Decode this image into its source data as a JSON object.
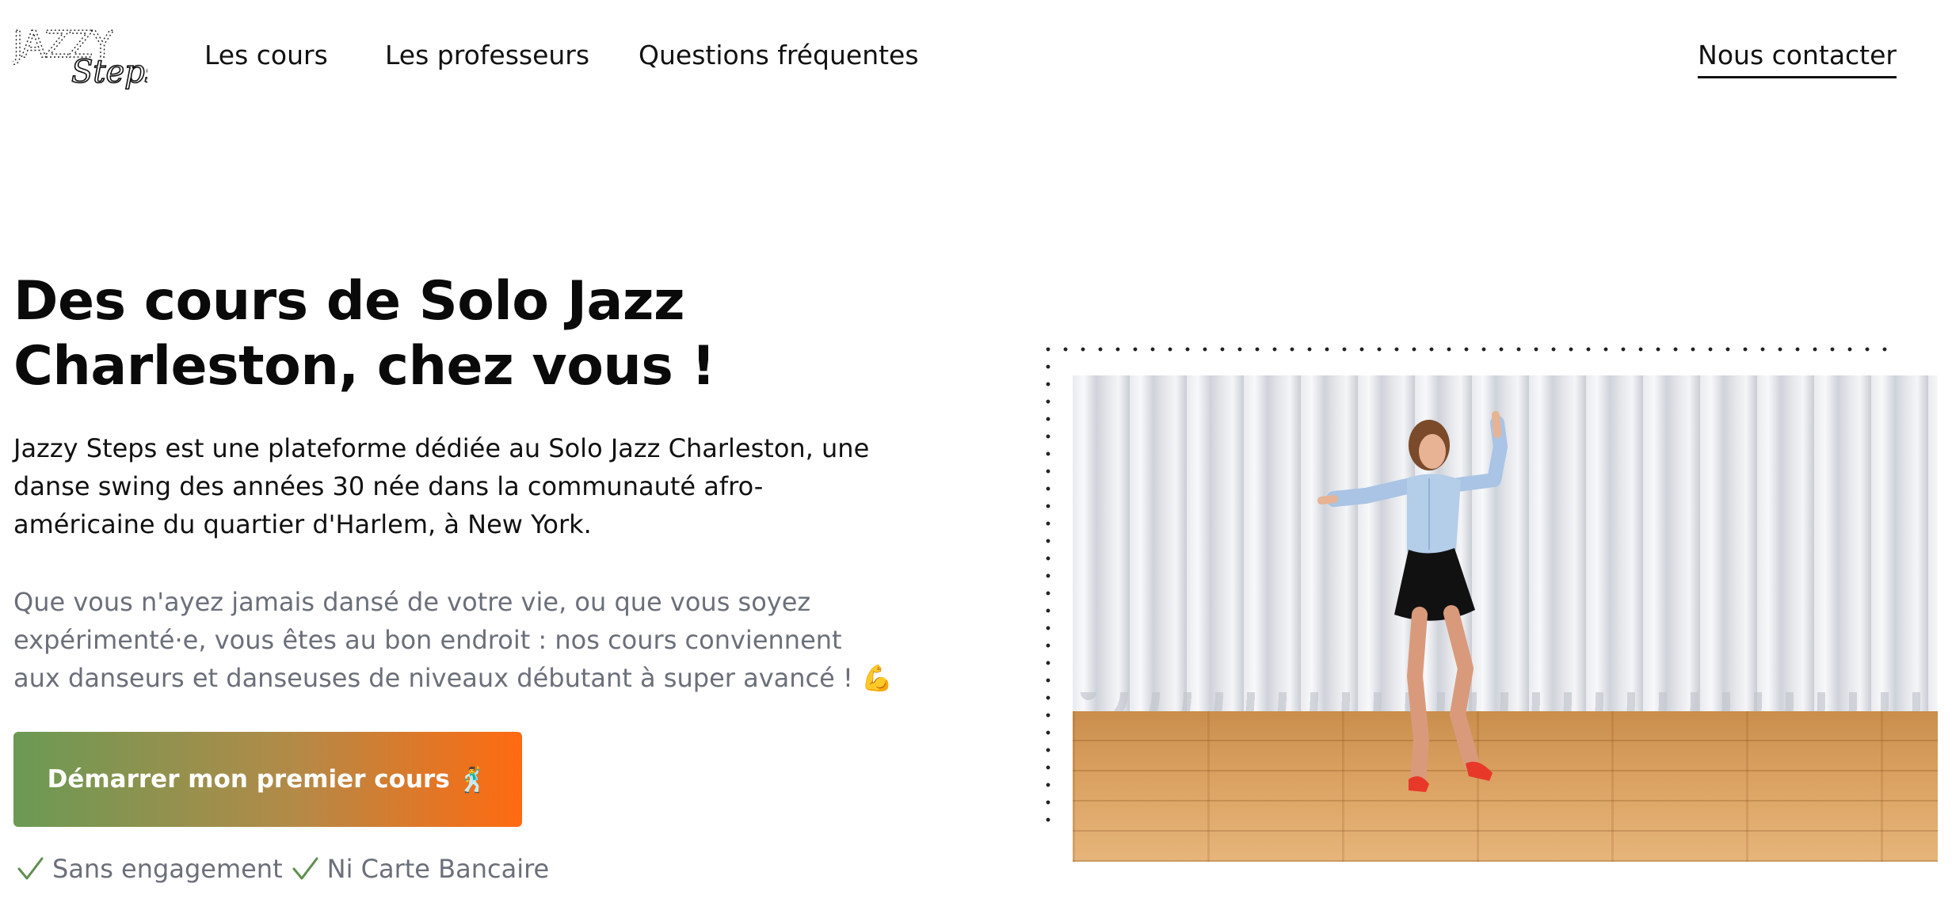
{
  "header": {
    "logo": {
      "line1": "JAZZY",
      "line2": "Steps"
    },
    "nav": [
      {
        "label": "Les cours"
      },
      {
        "label": "Les professeurs"
      },
      {
        "label": "Questions fréquentes"
      }
    ],
    "contact_label": "Nous contacter"
  },
  "hero": {
    "title": "Des cours de Solo Jazz Charleston, chez vous !",
    "lead": "Jazzy Steps est une plateforme dédiée au Solo Jazz Charleston, une danse swing des années 30 née dans la communauté afro-américaine du quartier d'Harlem, à New York.",
    "sub": "Que vous n'ayez jamais dansé de votre vie, ou que vous soyez expérimenté·e, vous êtes au bon endroit : nos cours conviennent aux danseurs et danseuses de niveaux débutant à super avancé ! 💪",
    "cta_label": "Démarrer mon premier cours",
    "cta_emoji": "🕺",
    "perks": [
      "Sans engagement",
      "Ni Carte Bancaire"
    ]
  },
  "colors": {
    "cta_start": "#6a9a54",
    "cta_end": "#ff6a10",
    "check": "#5f8f4f",
    "muted_text": "#6b6f7a"
  },
  "icons": [
    "check-icon",
    "check-icon"
  ]
}
